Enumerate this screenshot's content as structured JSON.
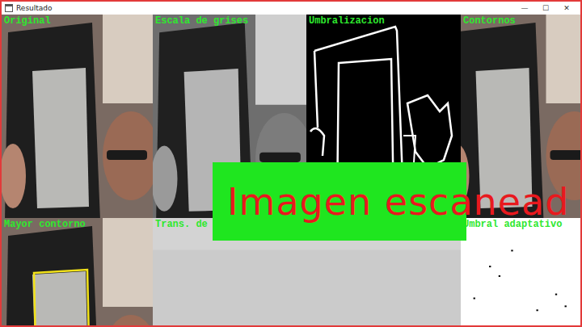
{
  "window": {
    "title": "Resultado",
    "controls": [
      "—",
      "☐",
      "✕"
    ]
  },
  "panels": [
    {
      "label": "Original",
      "kind": "photo"
    },
    {
      "label": "Escala de grises",
      "kind": "gray"
    },
    {
      "label": "Umbralizacion",
      "kind": "threshold"
    },
    {
      "label": "Contornos",
      "kind": "photo"
    },
    {
      "label": "Mayor contorno",
      "kind": "contour"
    },
    {
      "label": "Trans. de",
      "kind": "warp"
    },
    {
      "kind": "warp"
    },
    {
      "label": "Umbral adaptativo",
      "kind": "adaptive"
    }
  ],
  "overlay": {
    "text": "Imagen escanead"
  }
}
